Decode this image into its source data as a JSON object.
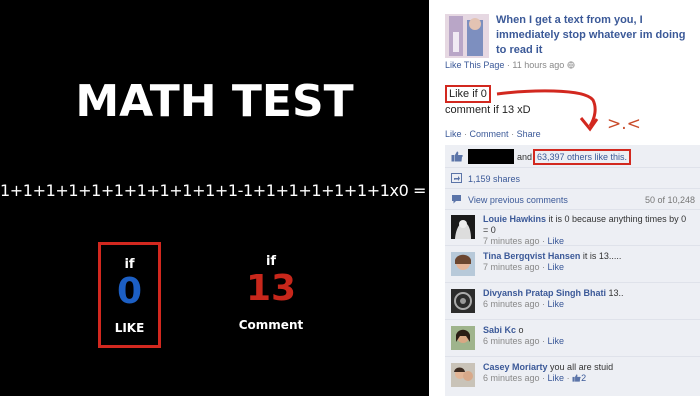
{
  "math_image": {
    "title": "MATH TEST",
    "equation": "1+1+1+1+1+1+1+1+1+1+1-1+1+1+1+1+1+1x0 = ?",
    "like_choice": {
      "if_label": "if",
      "value": "0",
      "label": "LIKE"
    },
    "comment_choice": {
      "if_label": "if",
      "value": "13",
      "label": "Comment"
    }
  },
  "post": {
    "title": "When I get a text from you, I immediately stop whatever im doing to read it",
    "page_link": "Like This Page",
    "time": "11 hours ago",
    "line1": "Like if 0",
    "line2": "comment if 13 xD",
    "annotation": ">.<",
    "actions": {
      "like": "Like",
      "comment": "Comment",
      "share": "Share"
    }
  },
  "ufi": {
    "likes_and": "and",
    "likes_count": "63,397 others like this.",
    "shares": "1,159 shares",
    "view_previous": "View previous comments",
    "comment_count": "50 of 10,248"
  },
  "comments": [
    {
      "name": "Louie Hawkins",
      "text": "it is 0 because anything times by 0 = 0",
      "time": "7 minutes ago",
      "like": "Like",
      "likes": ""
    },
    {
      "name": "Tina Bergqvist Hansen",
      "text": "it is 13.....",
      "time": "7 minutes ago",
      "like": "Like",
      "likes": ""
    },
    {
      "name": "Divyansh Pratap Singh Bhati",
      "text": "13..",
      "time": "6 minutes ago",
      "like": "Like",
      "likes": ""
    },
    {
      "name": "Sabi Kc",
      "text": "o",
      "time": "6 minutes ago",
      "like": "Like",
      "likes": ""
    },
    {
      "name": "Casey Moriarty",
      "text": "you all are stuid",
      "time": "6 minutes ago",
      "like": "Like",
      "likes": "2"
    }
  ],
  "colors": {
    "facebook_blue": "#3b5998",
    "highlight_red": "#d2281f",
    "like_blue": "#1c5fc4",
    "comment_red": "#c8271b"
  },
  "icons": [
    "thumbs-up-icon",
    "share-icon",
    "comment-bubble-icon",
    "globe-icon"
  ]
}
